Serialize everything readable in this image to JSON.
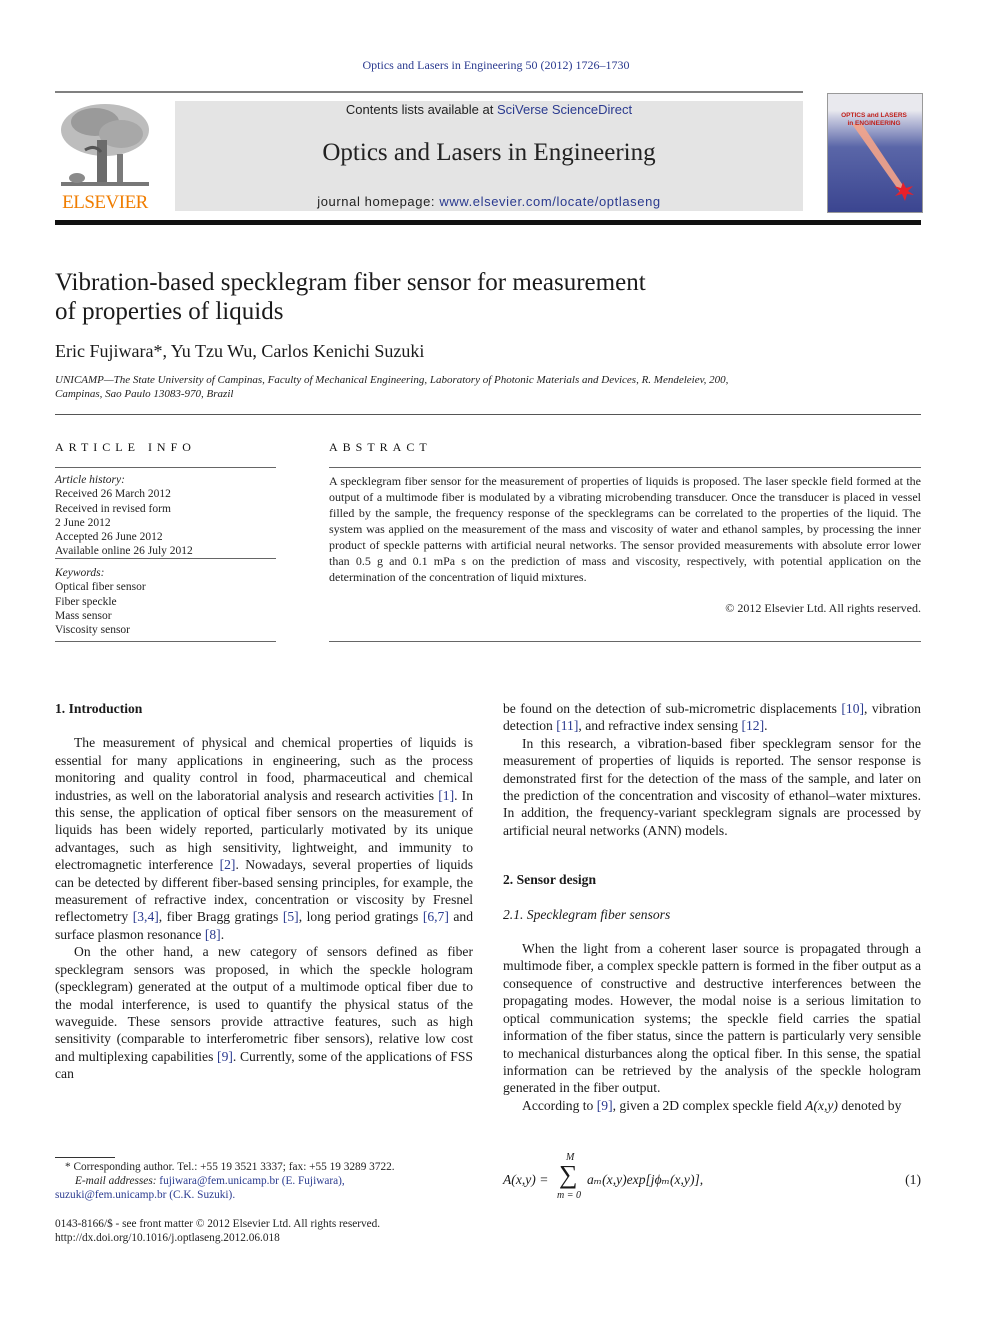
{
  "running_head": "Optics and Lasers in Engineering 50 (2012) 1726–1730",
  "header": {
    "publisher": "ELSEVIER",
    "contents_prefix": "Contents lists available at ",
    "contents_link": "SciVerse ScienceDirect",
    "journal_title": "Optics and Lasers in Engineering",
    "homepage_prefix": "journal homepage: ",
    "homepage_link": "www.elsevier.com/locate/optlaseng",
    "cover_title_line1": "OPTICS and LASERS",
    "cover_title_line2": "in ENGINEERING",
    "colors": {
      "publisher_orange": "#f07d00",
      "link_blue": "#2a3a8f",
      "banner_gray": "#e4e4e4"
    }
  },
  "article": {
    "title_line1": "Vibration-based specklegram fiber sensor for measurement",
    "title_line2": "of properties of liquids",
    "authors": "Eric Fujiwara*, Yu Tzu Wu, Carlos Kenichi Suzuki",
    "affiliation_line1": "UNICAMP—The State University of Campinas, Faculty of Mechanical Engineering, Laboratory of Photonic Materials and Devices, R. Mendeleiev, 200,",
    "affiliation_line2": "Campinas, Sao Paulo 13083-970, Brazil"
  },
  "article_info": {
    "heading": "ARTICLE INFO",
    "history_label": "Article history:",
    "history": [
      "Received 26 March 2012",
      "Received in revised form",
      "2 June 2012",
      "Accepted 26 June 2012",
      "Available online 26 July 2012"
    ],
    "keywords_label": "Keywords:",
    "keywords": [
      "Optical fiber sensor",
      "Fiber speckle",
      "Mass sensor",
      "Viscosity sensor"
    ]
  },
  "abstract": {
    "heading": "ABSTRACT",
    "text": "A specklegram fiber sensor for the measurement of properties of liquids is proposed. The laser speckle field formed at the output of a multimode fiber is modulated by a vibrating microbending transducer. Once the transducer is placed in vessel filled by the sample, the frequency response of the specklegrams can be correlated to the properties of the liquid. The system was applied on the measurement of the mass and viscosity of water and ethanol samples, by processing the inner product of speckle patterns with artificial neural networks. The sensor provided measurements with absolute error lower than 0.5 g and 0.1 mPa s on the prediction of mass and viscosity, respectively, with potential application on the determination of the concentration of liquid mixtures.",
    "copyright": "© 2012 Elsevier Ltd. All rights reserved."
  },
  "body": {
    "sec1_heading": "1.  Introduction",
    "sec1_p1_a": "The measurement of physical and chemical properties of liquids is essential for many applications in engineering, such as the process monitoring and quality control in food, pharmaceutical and chemical industries, as well on the laboratorial analysis and research activities ",
    "ref1": "[1]",
    "sec1_p1_b": ". In this sense, the application of optical fiber sensors on the measurement of liquids has been widely reported, particularly motivated by its unique advantages, such as high sensitivity, lightweight, and immunity to electromagnetic interference ",
    "ref2": "[2]",
    "sec1_p1_c": ". Nowadays, several properties of liquids can be detected by different fiber-based sensing principles, for example, the measurement of refractive index, concentration or viscosity by Fresnel reflectometry ",
    "ref34": "[3,4]",
    "sec1_p1_d": ", fiber Bragg gratings ",
    "ref5": "[5]",
    "sec1_p1_e": ", long period gratings ",
    "ref67": "[6,7]",
    "sec1_p1_f": " and surface plasmon resonance ",
    "ref8": "[8]",
    "sec1_p1_g": ".",
    "sec1_p2_a": "On the other hand, a new category of sensors defined as fiber specklegram sensors was proposed, in which the speckle hologram (specklegram) generated at the output of a multimode optical fiber due to the modal interference, is used to quantify the physical status of the waveguide. These sensors provide attractive features, such as high sensitivity (comparable to interferometric fiber sensors), relative low cost and multiplexing capabilities ",
    "ref9": "[9]",
    "sec1_p2_b": ". Currently, some of the applications of FSS can be found on the detection of sub-micrometric displacements ",
    "ref10": "[10]",
    "sec1_p2_c": ", vibration detection ",
    "ref11": "[11]",
    "sec1_p2_d": ", and refractive index sensing ",
    "ref12": "[12]",
    "sec1_p2_e": ".",
    "sec1_p3": "In this research, a vibration-based fiber specklegram sensor for the measurement of properties of liquids is reported. The sensor response is demonstrated first for the detection of the mass of the sample, and later on the prediction of the concentration and viscosity of ethanol–water mixtures. In addition, the frequency-variant specklegram signals are processed by artificial neural networks (ANN) models.",
    "sec2_heading": "2.  Sensor design",
    "sec21_heading": "2.1.  Specklegram fiber sensors",
    "sec21_p1": "When the light from a coherent laser source is propagated through a multimode fiber, a complex speckle pattern is formed in the fiber output as a consequence of constructive and destructive interferences between the propagating modes. However, the modal noise is a serious limitation to optical communication systems; the speckle field carries the spatial information of the fiber status, since the pattern is particularly very sensible to mechanical disturbances along the optical fiber. In this sense, the spatial information can be retrieved by the analysis of the speckle hologram generated in the fiber output.",
    "sec21_p2_a": "According to ",
    "sec21_ref9": "[9]",
    "sec21_p2_b": ", given a 2D complex speckle field ",
    "sec21_p2_field": "A(x,y)",
    "sec21_p2_c": " denoted by",
    "equation": {
      "lhs": "A(x,y) =",
      "sum_upper": "M",
      "sum_lower": "m = 0",
      "rhs": "a_m(x,y)exp[jφ_m(x,y)],",
      "rhs_display": "aₘ(x,y)exp[jϕₘ(x,y)],",
      "number": "(1)"
    }
  },
  "footnotes": {
    "corresponding": "* Corresponding author. Tel.: +55 19 3521 3337; fax: +55 19 3289 3722.",
    "email_label": "E-mail addresses:",
    "email1": " fujiwara@fem.unicamp.br (E. Fujiwara),",
    "email2": "suzuki@fem.unicamp.br (C.K. Suzuki).",
    "front_matter": "0143-8166/$ - see front matter © 2012 Elsevier Ltd. All rights reserved.",
    "doi": "http://dx.doi.org/10.1016/j.optlaseng.2012.06.018"
  }
}
